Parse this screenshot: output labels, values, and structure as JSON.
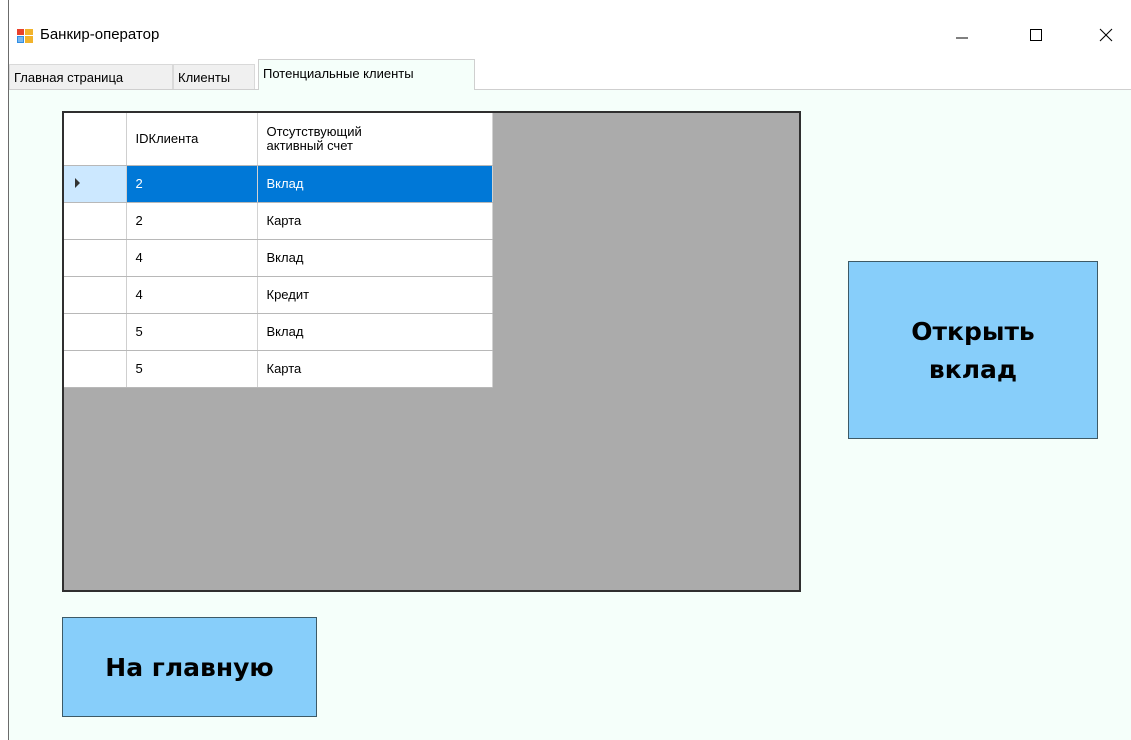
{
  "window": {
    "title": "Банкир-оператор",
    "icon": "winforms-app-icon",
    "controls": [
      "minimize-icon",
      "maximize-icon",
      "close-icon"
    ]
  },
  "tabs": [
    {
      "label": "Главная страница",
      "active": false
    },
    {
      "label": "Клиенты",
      "active": false
    },
    {
      "label": "Потенциальные клиенты",
      "active": true
    }
  ],
  "grid": {
    "columns": [
      "IDКлиента",
      "Отсутствующий активный счет"
    ],
    "rows": [
      {
        "id": "2",
        "account": "Вклад",
        "selected": true
      },
      {
        "id": "2",
        "account": "Карта",
        "selected": false
      },
      {
        "id": "4",
        "account": "Вклад",
        "selected": false
      },
      {
        "id": "4",
        "account": "Кредит",
        "selected": false
      },
      {
        "id": "5",
        "account": "Вклад",
        "selected": false
      },
      {
        "id": "5",
        "account": "Карта",
        "selected": false
      }
    ]
  },
  "buttons": {
    "open_deposit": "Открыть вклад",
    "to_main": "На главную"
  },
  "colors": {
    "panel_bg": "#f5fffa",
    "button_bg": "#87cefa",
    "grid_bg": "#ababab",
    "selection": "#0078d7"
  }
}
